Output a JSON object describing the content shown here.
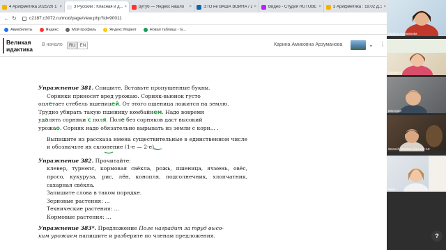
{
  "browser": {
    "tabs": [
      {
        "title": "4 Арифметика 2025/26 1",
        "favicon": "#f0b400"
      },
      {
        "title": "3 Русский : Класная и д...",
        "favicon": "#e8eaed",
        "active": true
      },
      {
        "title": "рутуб — Яндекс нашло",
        "favicon": "#f33"
      },
      {
        "title": "ЭТО не ВАША ВОЙНА / 2",
        "favicon": "#16a"
      },
      {
        "title": "Видео - Студия RUTUBE",
        "favicon": "#b2f"
      },
      {
        "title": "3 Арифметика : 19.02 Д.З.",
        "favicon": "#f0b400"
      }
    ],
    "url": "c2187.c3072.ru/mod/page/view.php?id=90011",
    "bookmarks": [
      {
        "label": "Авиабилеты",
        "color": "#1a73e8"
      },
      {
        "label": "Яндекс",
        "color": "#f33"
      },
      {
        "label": "Мой профиль",
        "color": "#666"
      },
      {
        "label": "Яндекс Маркет",
        "color": "#fc0"
      },
      {
        "label": "Новая таблица - G...",
        "color": "#0f9d58"
      }
    ]
  },
  "site": {
    "logo_line1": "Великая",
    "logo_line2": "идактика",
    "home_link": "В начало",
    "lang_ru": "RU",
    "lang_en": "EN",
    "user_name": "Карина Амиковна Арзуманова",
    "more_icon": "⋮"
  },
  "doc": {
    "ex381_title": "Упражнение 381.",
    "ex381_task": " Спишите. Вставьте пропущенные буквы.",
    "ex381_l1": "Сорняки приносят вред урожаю. Сорняк-вьюнок густо",
    "ex381_l2a": "опл",
    "ex381_l2b": "тает стебель пшениц",
    "ex381_l2c": ". От этого пшеница ложится на землю.",
    "ex381_l3a": "Трудно убирать такую пшеницу комбайн",
    "ex381_l3b": ". Надо вовремя",
    "ex381_l4a": "уд",
    "ex381_l4b": "лять сорняки ",
    "ex381_l4c": " пол",
    "ex381_l4d": ". Пол",
    "ex381_l4e": " без сорняков даст высокий",
    "ex381_l5a": "урожа",
    "ex381_l5b": ". Сорняк надо обязательно вырывать из земли с корн... .",
    "ex381_note": "Выпишите из рассказа имена существительные в единственном числе и обозначьте их склонение (1-е — 2-е).",
    "ex382_title": "Упражнение 382.",
    "ex382_task": " Прочитайте:",
    "ex382_words": "клевер, турнепс, кормовая свёкла, рожь, пшеница, ячмень, овёс, просо, кукуруза, рис, лён, конопля, подсолнечник, хлопчатник, сахарная свёкла.",
    "ex382_note": "Запишите слова в таком порядке.",
    "ex382_r1": "Зерновые растения: ...",
    "ex382_r2": "Технические растения: ...",
    "ex382_r3": "Кормовые растения: ...",
    "ex383_title": "Упражнение 383*.",
    "ex383_task_a": " Предложение ",
    "ex383_task_b": "Поле наградит за труд высо-",
    "ex383_task_c": "ким урожаем",
    "ex383_task_d": " напишите и разберите по членам предложения.",
    "ink_e": "е",
    "ink_ei": "ей",
    "ink_a": "а",
    "ink_o": "о",
    "ink_s": "с",
    "ink_ya": "я",
    "ink_e2": "е",
    "ink_em": "ем"
  },
  "participants": [
    {
      "name": "Карина Арзуманова"
    },
    {
      "name": "Mayakma"
    },
    {
      "name": "виктория"
    },
    {
      "name": "Wunsch Stephan (3) 3 лет-10"
    },
    {
      "name": "Кира"
    }
  ],
  "help_label": "?"
}
